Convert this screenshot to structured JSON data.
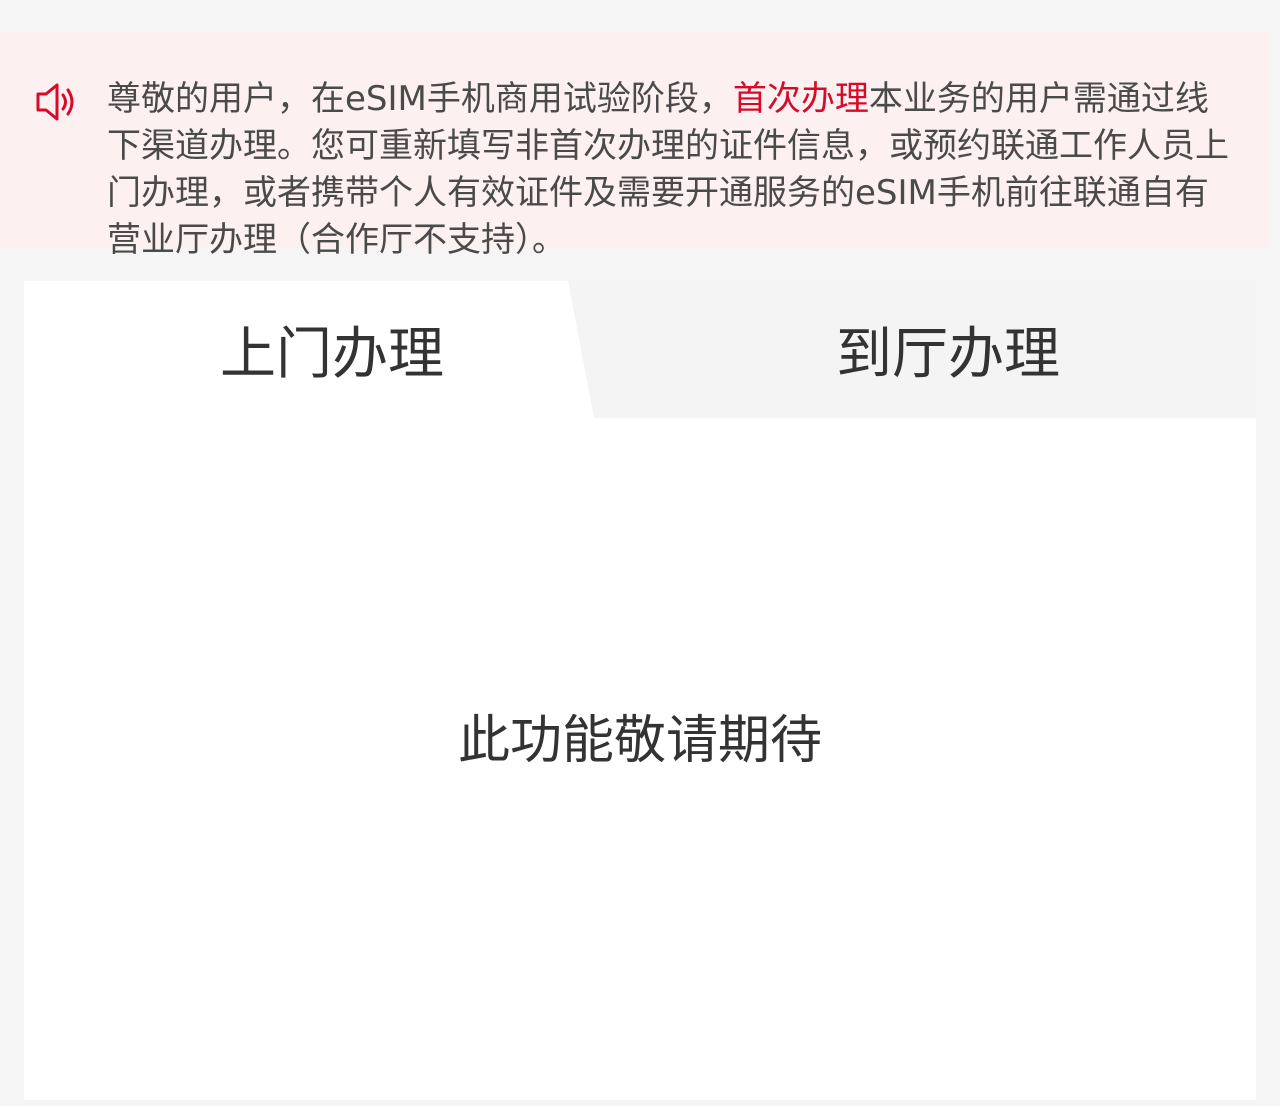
{
  "notice": {
    "icon": "speaker-icon",
    "text_before": "尊敬的用户，在eSIM手机商用试验阶段，",
    "highlight": "首次办理",
    "text_after": "本业务的用户需通过线下渠道办理。您可重新填写非首次办理的证件信息，或预约联通工作人员上门办理，或者携带个人有效证件及需要开通服务的eSIM手机前往联通自有营业厅办理（合作厅不支持）。",
    "highlight_color": "#d80a2a"
  },
  "tabs": {
    "home_service": "上门办理",
    "store_service": "到厅办理",
    "active": "home_service"
  },
  "content": {
    "message": "此功能敬请期待"
  }
}
